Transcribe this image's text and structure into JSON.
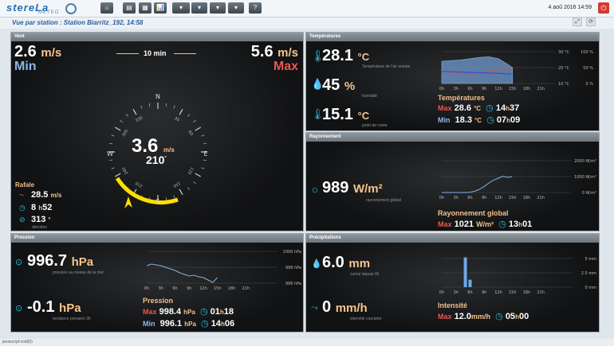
{
  "topbar": {
    "brand": "stereLa",
    "brand_sub": "METEO",
    "buttons": [
      "⌂",
      "▤",
      "▦",
      "📊",
      "▾",
      "▾",
      "▾",
      "▾",
      "?"
    ],
    "datetime": "4 aoû 2016 14:59",
    "logout_icon": "⏻"
  },
  "station": {
    "title": "Vue par station : Station Biarritz_192, 14:58",
    "view_buttons": [
      "⤢",
      "⟳"
    ]
  },
  "wind": {
    "header": "Vent",
    "min_value": "2.6",
    "min_unit": "m/s",
    "min_label": "Min",
    "max_value": "5.6",
    "max_unit": "m/s",
    "max_label": "Max",
    "period": "10 min",
    "center_speed": "3.6",
    "center_unit": "m/s",
    "center_dir": "210",
    "deg": "°",
    "compass_labels": [
      "N",
      "E",
      "S",
      "W"
    ],
    "degree_ticks": [
      "0",
      "30",
      "60",
      "90",
      "120",
      "150",
      "180",
      "210",
      "240",
      "270",
      "300",
      "330"
    ],
    "gust_label": "Rafale",
    "gust_value": "28.5",
    "gust_unit": "m/s",
    "gust_time_h": "8",
    "gust_time_h_unit": "h",
    "gust_time_m": "52",
    "gust_dir": "313",
    "gust_dir_unit": "°",
    "gust_dir_label": "direction"
  },
  "temperatures": {
    "header": "Températures",
    "air_value": "28.1",
    "air_unit": "°C",
    "air_label": "Température de l'air minute",
    "hum_value": "45",
    "hum_unit": "%",
    "hum_label": "humidité",
    "dew_value": "15.1",
    "dew_unit": "°C",
    "dew_label": "point de rosée",
    "stats_title": "Températures",
    "max_label": "Max",
    "max_value": "28.6",
    "max_unit": "°C",
    "max_time_h": "14",
    "max_time_m": "37",
    "min_label": "Min",
    "min_value": "18.3",
    "min_unit": "°C",
    "min_time_h": "07",
    "min_time_m": "09",
    "h": "h"
  },
  "rayonnement": {
    "header": "Rayonnement",
    "value": "989",
    "unit": "W/m²",
    "label": "rayonnement global",
    "stats_title": "Rayonnement global",
    "max_label": "Max",
    "max_value": "1021",
    "max_unit": "W/m²",
    "max_time_h": "13",
    "max_time_m": "01",
    "h": "h"
  },
  "pression": {
    "header": "Pression",
    "value": "996.7",
    "unit": "hPa",
    "label": "pression au niveau de la mer",
    "trend_value": "-0.1",
    "trend_unit": "hPa",
    "trend_label": "tendance pression 3h",
    "stats_title": "Pression",
    "max_label": "Max",
    "max_value": "998.4",
    "max_unit": "hPa",
    "max_time_h": "01",
    "max_time_m": "18",
    "min_label": "Min",
    "min_value": "996.1",
    "min_unit": "hPa",
    "min_time_h": "14",
    "min_time_m": "06",
    "h": "h"
  },
  "precipitations": {
    "header": "Précipitations",
    "cumul_value": "6.0",
    "cumul_unit": "mm",
    "cumul_label": "cumul depuis 0h",
    "intensity_value": "0",
    "intensity_unit": "mm/h",
    "intensity_label": "intensité courante",
    "stats_title": "Intensité",
    "max_label": "Max",
    "max_value": "12.0",
    "max_unit": "mm/h",
    "max_time_h": "05",
    "max_time_m": "00",
    "h": "h"
  },
  "status": "javascript:void(0)",
  "chart_data": [
    {
      "type": "area",
      "panel": "temperatures",
      "x": [
        "0h",
        "3h",
        "6h",
        "9h",
        "12h",
        "15h",
        "18h",
        "21h"
      ],
      "y_right_ticks_temp": [
        "30 °C",
        "20 °C",
        "10 °C"
      ],
      "y_right_ticks_hum": [
        "100 %",
        "50 %",
        "0 %"
      ],
      "series": [
        {
          "values_hours": [
            0,
            2,
            4,
            6,
            8,
            10,
            12,
            14,
            15
          ],
          "values": [
            30,
            33,
            32,
            30,
            32,
            38,
            44,
            45,
            45
          ],
          "color": "#e04a4a"
        },
        {
          "values_hours": [
            0,
            2,
            4,
            6,
            8,
            10,
            12,
            14,
            15
          ],
          "values": [
            70,
            72,
            74,
            78,
            82,
            84,
            78,
            60,
            50
          ],
          "color": "#8fb8e8"
        },
        {
          "values_hours": [
            0,
            2,
            4,
            6,
            8,
            10,
            12,
            14,
            15
          ],
          "values": [
            38,
            37,
            36,
            35,
            34,
            33,
            32,
            30,
            30
          ],
          "color": "#3050d0"
        }
      ]
    },
    {
      "type": "line",
      "panel": "rayonnement",
      "x": [
        "0h",
        "3h",
        "6h",
        "9h",
        "12h",
        "15h",
        "18h",
        "21h"
      ],
      "y_ticks": [
        "2000 W/m²",
        "1000 W/m²",
        "0 W/m²"
      ],
      "series": [
        {
          "hours": [
            0,
            3,
            5,
            6,
            7,
            8,
            9,
            10,
            11,
            12,
            13,
            14,
            14.9
          ],
          "values": [
            0,
            0,
            0,
            20,
            80,
            200,
            380,
            600,
            780,
            900,
            1021,
            950,
            989
          ]
        }
      ]
    },
    {
      "type": "line",
      "panel": "pression",
      "x": [
        "0h",
        "3h",
        "6h",
        "9h",
        "12h",
        "15h",
        "18h",
        "21h"
      ],
      "y_ticks": [
        "1000 hPa",
        "998 hPa",
        "996 hPa"
      ],
      "series": [
        {
          "hours": [
            0,
            1,
            2,
            3,
            4,
            5,
            6,
            7,
            8,
            9,
            10,
            11,
            12,
            13,
            14,
            15
          ],
          "values": [
            998.2,
            998.4,
            998.3,
            998.2,
            998.0,
            997.8,
            997.6,
            997.3,
            997.1,
            996.9,
            997.0,
            996.8,
            996.7,
            996.4,
            996.1,
            996.7
          ]
        }
      ]
    },
    {
      "type": "bar",
      "panel": "precipitations",
      "x": [
        "0h",
        "3h",
        "6h",
        "9h",
        "12h",
        "15h",
        "18h",
        "21h"
      ],
      "y_ticks": [
        "5 mm",
        "2.5 mm",
        "0 mm"
      ],
      "series": [
        {
          "hours": [
            5,
            6
          ],
          "values": [
            5.2,
            1.3
          ]
        }
      ]
    }
  ]
}
